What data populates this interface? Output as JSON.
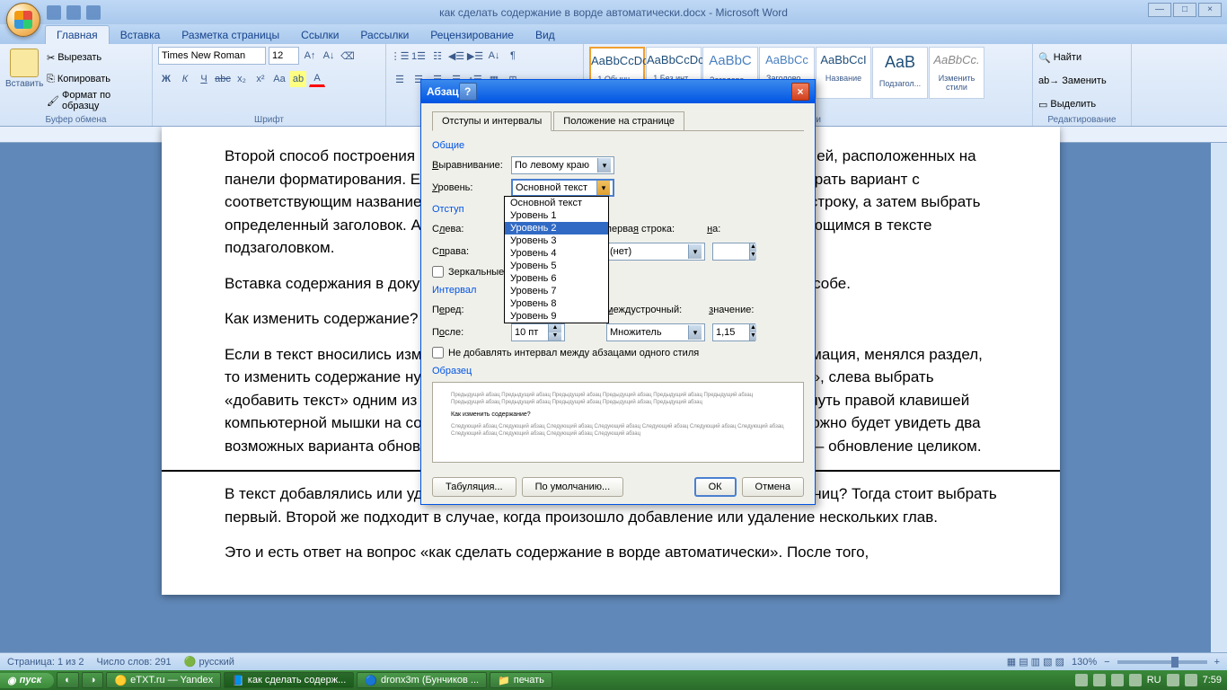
{
  "window": {
    "title": "как сделать содержание в ворде автоматически.docx - Microsoft Word"
  },
  "ribbon": {
    "tabs": [
      "Главная",
      "Вставка",
      "Разметка страницы",
      "Ссылки",
      "Рассылки",
      "Рецензирование",
      "Вид"
    ],
    "active_tab": 0,
    "groups": {
      "clipboard": {
        "label": "Буфер обмена",
        "paste": "Вставить",
        "cut": "Вырезать",
        "copy": "Копировать",
        "format_painter": "Формат по образцу"
      },
      "font": {
        "label": "Шрифт",
        "family": "Times New Roman",
        "size": "12"
      },
      "paragraph": {
        "label": "Абзац"
      },
      "styles": {
        "label": "Стили",
        "items": [
          {
            "sample": "AaBbCcDc",
            "name": "1 Обычн..."
          },
          {
            "sample": "AaBbCcDc",
            "name": "1 Без инт..."
          },
          {
            "sample": "AaBbC",
            "name": "Заголово..."
          },
          {
            "sample": "AaBbCc",
            "name": "Заголово..."
          },
          {
            "sample": "AaBbCcI",
            "name": "Название"
          },
          {
            "sample": "AaB",
            "name": "Подзагол..."
          },
          {
            "sample": "AaBbCc.",
            "name": "Изменить стили"
          }
        ]
      },
      "editing": {
        "label": "Редактирование",
        "find": "Найти",
        "replace": "Заменить",
        "select": "Выделить"
      }
    }
  },
  "document": {
    "p1": "Второй способ построения меню состоит в его создании вручную при помощи стилей, расположенных на панели форматирования. Если вы добавляете главу первого уровня, то нужно выбрать вариант с соответствующим названием. Для этого необходимо поставить курсор на нужную строку, а затем выбрать определенный заголовок. Аналогичным образом следует поступить с каждым имеющимся в тексте подзаголовком.",
    "p2": "Вставка содержания в документ происходит таким же образом, как и в первом способе.",
    "p3": "Как изменить содержание?",
    "p4": "Если в текст вносились изменения, например, удалялась или добавлялась информация, менялся раздел, то изменить содержание нужно следующим образом: перейти на вкладку «ссылки», слева выбрать «добавить текст» одним из предложенных способов. После чего необходимо кликнуть правой клавишей компьютерной мышки на содержание и выбрать строку «обновить поле». Далее можно будет увидеть два возможных варианта обновления. Первый – обновление только страниц, а второй – обновление целиком.",
    "p5": "В текст добавлялись или удалялись абзацы, из-за чего произошло смещение страниц? Тогда стоит выбрать первый. Второй же подходит в случае, когда произошло добавление или удаление нескольких глав.",
    "p6": "Это и есть ответ на вопрос «как сделать содержание в ворде автоматически». После того,"
  },
  "dialog": {
    "title": "Абзац",
    "tabs": [
      "Отступы и интервалы",
      "Положение на странице"
    ],
    "section_general": "Общие",
    "alignment_label": "Выравнивание:",
    "alignment_value": "По левому краю",
    "level_label": "Уровень:",
    "level_value": "Основной текст",
    "level_options": [
      "Основной текст",
      "Уровень 1",
      "Уровень 2",
      "Уровень 3",
      "Уровень 4",
      "Уровень 5",
      "Уровень 6",
      "Уровень 7",
      "Уровень 8",
      "Уровень 9"
    ],
    "level_highlighted": 2,
    "section_indent": "Отступ",
    "left_label": "Слева:",
    "right_label": "Справа:",
    "first_line_label": "первая строка:",
    "by_label": "на:",
    "first_line_value": "(нет)",
    "mirror_label": "Зеркальные отступы",
    "section_spacing": "Интервал",
    "before_label": "Перед:",
    "before_value": "0 пт",
    "after_label": "После:",
    "after_value": "10 пт",
    "line_spacing_label": "междустрочный:",
    "line_spacing_value": "Множитель",
    "at_label": "значение:",
    "at_value": "1,15",
    "no_space_label": "Не добавлять интервал между абзацами одного стиля",
    "section_preview": "Образец",
    "preview_text_before": "Предыдущий абзац Предыдущий абзац Предыдущий абзац Предыдущий абзац Предыдущий абзац Предыдущий абзац Предыдущий абзац Предыдущий абзац Предыдущий абзац Предыдущий абзац Предыдущий абзац",
    "preview_text_main": "Как изменить содержание?",
    "preview_text_after": "Следующий абзац Следующий абзац Следующий абзац Следующий абзац Следующий абзац Следующий абзац Следующий абзац Следующий абзац Следующий абзац Следующий абзац Следующий абзац",
    "btn_tabs": "Табуляция...",
    "btn_default": "По умолчанию...",
    "btn_ok": "ОК",
    "btn_cancel": "Отмена"
  },
  "statusbar": {
    "page": "Страница: 1 из 2",
    "words": "Число слов: 291",
    "lang": "русский",
    "zoom": "130%"
  },
  "taskbar": {
    "start": "пуск",
    "items": [
      "eTXT.ru — Yandex",
      "как сделать содерж...",
      "dronx3m (Бунчиков ...",
      "печать"
    ],
    "lang": "RU",
    "time": "7:59"
  }
}
